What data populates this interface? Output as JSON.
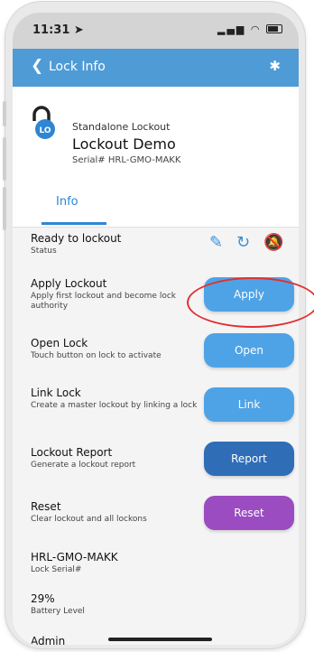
{
  "status_bar": {
    "time": "11:31 ➤"
  },
  "app_bar": {
    "title": "Lock Info",
    "back_icon": "chevron-left-icon",
    "bluetooth_icon": "bluetooth-icon"
  },
  "header": {
    "subtitle": "Standalone Lockout",
    "title": "Lockout Demo",
    "serial": "Serial# HRL-GMO-MAKK",
    "tab": "Info"
  },
  "rows": {
    "status": {
      "title": "Ready to lockout",
      "subtitle": "Status"
    },
    "apply": {
      "title": "Apply Lockout",
      "subtitle": "Apply first lockout and become lock authority",
      "button": "Apply"
    },
    "open": {
      "title": "Open Lock",
      "subtitle": "Touch button on lock to activate",
      "button": "Open"
    },
    "link": {
      "title": "Link Lock",
      "subtitle": "Create a master lockout by linking a lock",
      "button": "Link"
    },
    "report": {
      "title": "Lockout Report",
      "subtitle": "Generate a lockout report",
      "button": "Report"
    },
    "reset": {
      "title": "Reset",
      "subtitle": "Clear lockout and all lockons",
      "button": "Reset"
    },
    "serial": {
      "title": "HRL-GMO-MAKK",
      "subtitle": "Lock Serial#"
    },
    "battery": {
      "title": "29%",
      "subtitle": "Battery Level"
    },
    "admin": {
      "title": "Admin"
    }
  },
  "colors": {
    "primary": "#4f9bd6",
    "button_light": "#4ea3e6",
    "button_dark": "#2f6db7",
    "button_purple": "#9b4cc0",
    "annotation": "#e23030"
  }
}
